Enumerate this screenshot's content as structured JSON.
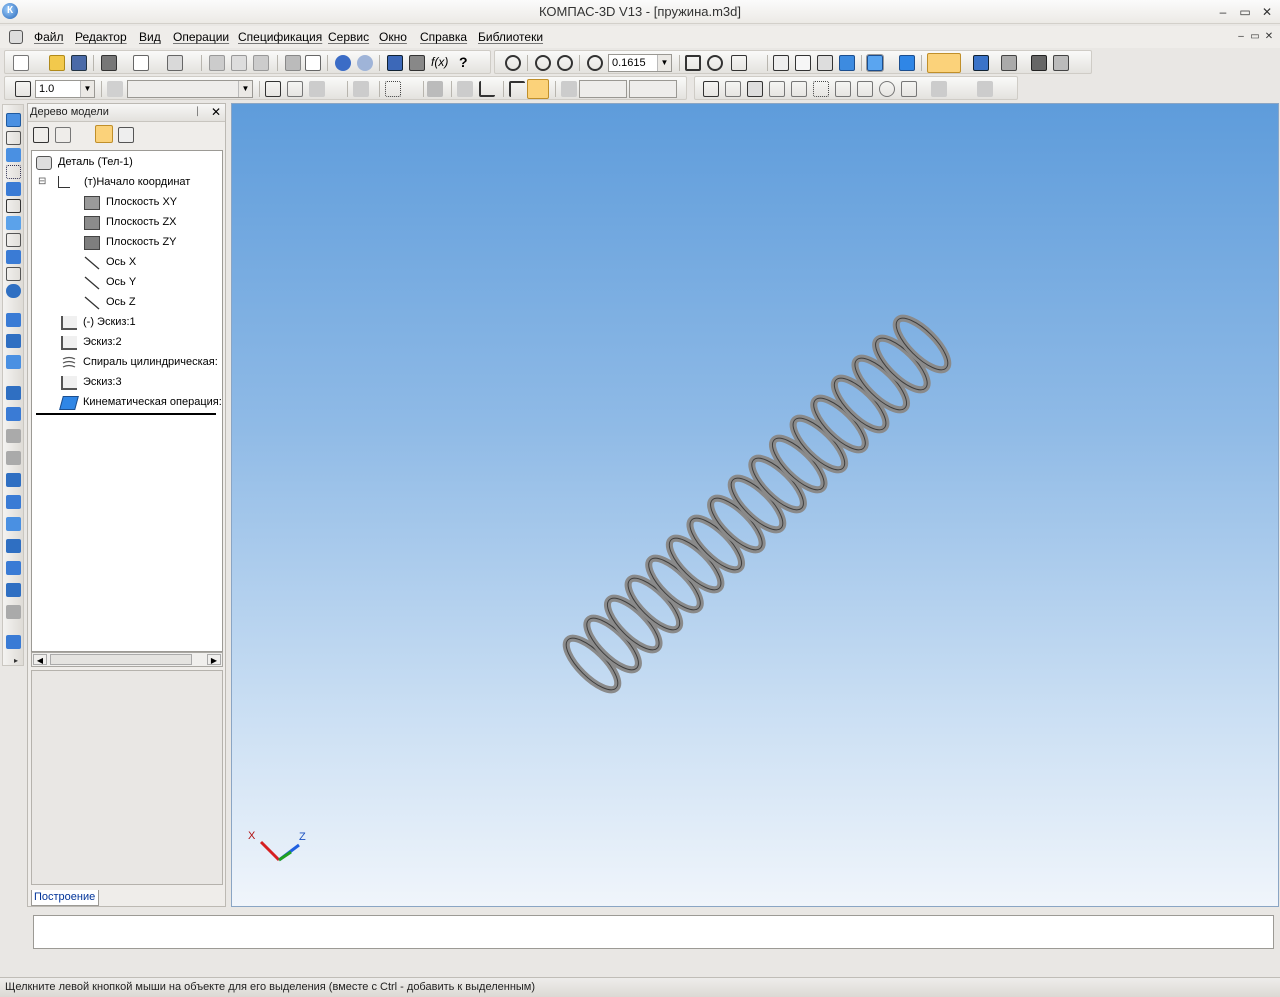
{
  "window": {
    "title": "КОМПАС-3D V13 - [пружина.m3d]",
    "logo": "К",
    "controls": {
      "minimize": "–",
      "maximize": "▭",
      "close": "✕"
    },
    "doc_controls": {
      "minimize": "–",
      "restore": "▭",
      "close": "✕"
    }
  },
  "menu": {
    "items": [
      "Файл",
      "Редактор",
      "Вид",
      "Операции",
      "Спецификация",
      "Сервис",
      "Окно",
      "Справка",
      "Библиотеки"
    ]
  },
  "toolbar": {
    "zoom_value": "0.1615",
    "scale_value": "1.0",
    "fx_label": "f(x)",
    "help_label": "?"
  },
  "tree_panel": {
    "title": "Дерево модели",
    "pin": "ᛁ",
    "close": "✕",
    "tab_label": "Построение",
    "nodes": [
      {
        "label": "Деталь (Тел-1)",
        "icon": "part-icon"
      },
      {
        "label": "(т)Начало координат",
        "icon": "origin-icon",
        "expander": "⊟"
      },
      {
        "label": "Плоскость XY",
        "icon": "plane-icon"
      },
      {
        "label": "Плоскость ZX",
        "icon": "plane-icon"
      },
      {
        "label": "Плоскость ZY",
        "icon": "plane-icon"
      },
      {
        "label": "Ось X",
        "icon": "axis-icon"
      },
      {
        "label": "Ось Y",
        "icon": "axis-icon"
      },
      {
        "label": "Ось Z",
        "icon": "axis-icon"
      },
      {
        "label": "(-) Эскиз:1",
        "icon": "sketch-icon"
      },
      {
        "label": "Эскиз:2",
        "icon": "sketch-icon"
      },
      {
        "label": "Спираль цилиндрическая:",
        "icon": "helix-icon"
      },
      {
        "label": "Эскиз:3",
        "icon": "sketch-icon"
      },
      {
        "label": "Кинематическая операция:",
        "icon": "sweep-icon"
      }
    ]
  },
  "viewport": {
    "axis_labels": {
      "x": "X",
      "z": "Z"
    },
    "colors": {
      "spring": "#8a8a8a",
      "sky_top": "#5e9cdb",
      "sky_bottom": "#f0f5fb",
      "axis_x": "#d62020",
      "axis_y": "#20a020",
      "axis_z": "#2060e0"
    }
  },
  "status": {
    "text": "Щелкните левой кнопкой мыши на объекте для его выделения (вместе с Ctrl - добавить к выделенным)"
  }
}
